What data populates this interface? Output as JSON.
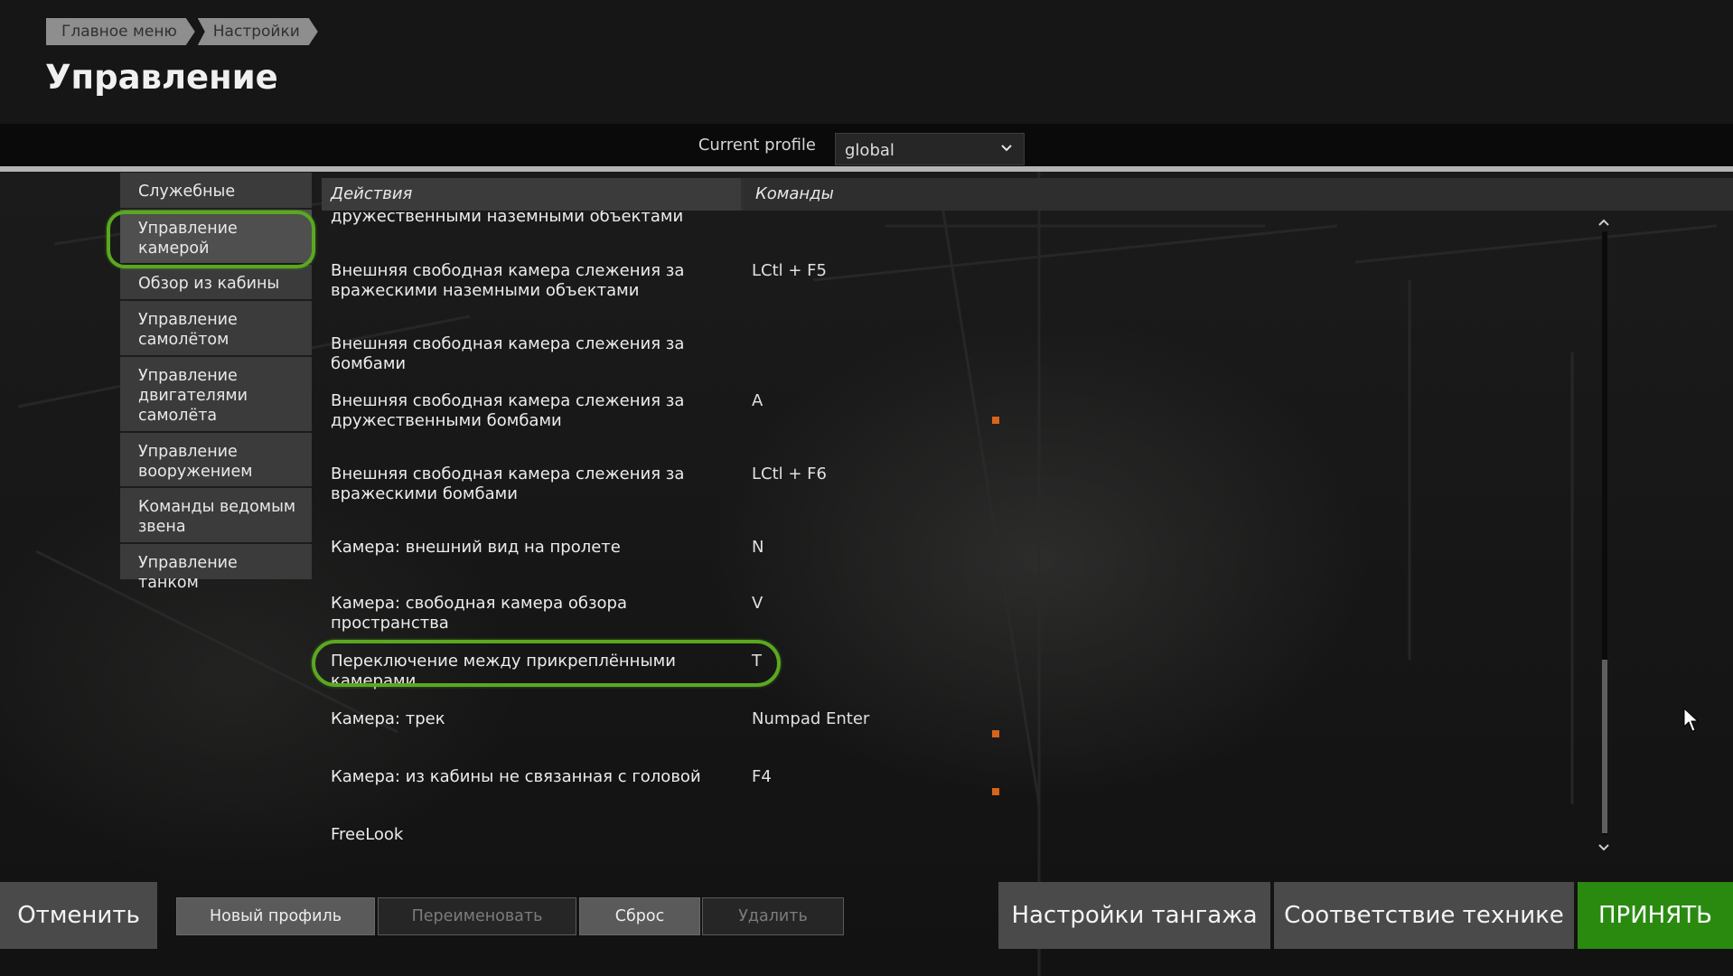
{
  "breadcrumb": [
    "Главное меню",
    "Настройки"
  ],
  "title": "Управление",
  "profile": {
    "label": "Current profile",
    "value": "global"
  },
  "categories": [
    "Служебные",
    "Управление камерой",
    "Обзор из кабины",
    "Управление самолётом",
    "Управление двигателями самолёта",
    "Управление вооружением",
    "Команды ведомым звена",
    "Управление танком"
  ],
  "active_category": "Управление камерой",
  "table": {
    "col_actions": "Действия",
    "col_commands": "Команды",
    "rows": [
      {
        "action": "дружественными наземными объектами",
        "command": "",
        "marked": false
      },
      {
        "action": "Внешняя свободная камера слежения за вражескими наземными объектами",
        "command": "LCtl + F5",
        "marked": false
      },
      {
        "action": "Внешняя свободная камера слежения за бомбами",
        "command": "",
        "marked": false
      },
      {
        "action": "Внешняя свободная камера слежения за дружественными бомбами",
        "command": "A",
        "marked": true
      },
      {
        "action": "Внешняя свободная камера слежения за вражескими бомбами",
        "command": "LCtl + F6",
        "marked": false
      },
      {
        "action": "Камера: внешний вид на пролете",
        "command": "N",
        "marked": false
      },
      {
        "action": "Камера: свободная камера обзора пространства",
        "command": "V",
        "marked": false
      },
      {
        "action": "Переключение между прикреплёнными камерами",
        "command": "T",
        "marked": false
      },
      {
        "action": "Камера: трек",
        "command": "Numpad Enter",
        "marked": true
      },
      {
        "action": "Камера: из кабины не связанная с головой",
        "command": "F4",
        "marked": true
      },
      {
        "action": "FreeLook",
        "command": "",
        "marked": false
      }
    ]
  },
  "buttons": {
    "cancel": "Отменить",
    "new_profile": "Новый профиль",
    "rename": "Переименовать",
    "reset": "Сброс",
    "delete": "Удалить",
    "pitch_settings": "Настройки тангажа",
    "vehicle_match": "Соответствие технике",
    "accept": "ПРИНЯТЬ"
  },
  "colors": {
    "accent_green": "#2a8a10",
    "highlight_green": "#5aa820",
    "marker_orange": "#d6641a"
  }
}
